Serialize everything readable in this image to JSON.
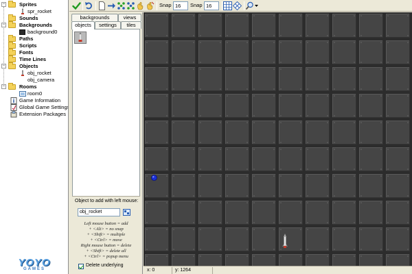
{
  "tree": {
    "sprites": "Sprites",
    "spr_rocket": "spr_rocket",
    "sounds": "Sounds",
    "backgrounds": "Backgrounds",
    "background0": "background0",
    "paths": "Paths",
    "scripts": "Scripts",
    "fonts": "Fonts",
    "time_lines": "Time Lines",
    "objects": "Objects",
    "obj_rocket": "obj_rocket",
    "obj_camera": "obj_camera",
    "rooms": "Rooms",
    "room0": "room0",
    "game_information": "Game Information",
    "global_game_settings": "Global Game Settings",
    "extension_packages": "Extension Packages",
    "expanded_symbol": "−"
  },
  "logo": {
    "main": "YOYO",
    "sub": "GAMES"
  },
  "toolbar": {
    "snap_x_label": "Snap X:",
    "snap_x_value": "16",
    "snap_y_label": "Snap Y:",
    "snap_y_value": "16"
  },
  "tabs": {
    "backgrounds": "backgrounds",
    "views": "views",
    "objects": "objects",
    "settings": "settings",
    "tiles": "tiles",
    "active": "objects"
  },
  "object_panel": {
    "title": "Object to add with left mouse:",
    "selected_object": "obj_rocket",
    "help_lines": [
      "Left mouse button = add",
      "+ <Alt> = no snap",
      "+ <Shift> = multiple",
      "+ <Ctrl> = move",
      "Right mouse button = delete",
      "+ <Shift> = delete all",
      "+ <Ctrl> = popup menu"
    ],
    "delete_underlying_label": "Delete underlying",
    "delete_underlying_checked": true
  },
  "room": {
    "background_color": "#3e3e3e",
    "grid_color": "#1e1e1e",
    "tile_color": "#454545",
    "tile_border_light": "#5a5a5a",
    "instances": [
      {
        "name": "obj_camera",
        "icon": "blue-ball-icon"
      },
      {
        "name": "obj_rocket",
        "icon": "rocket-icon"
      }
    ]
  },
  "status": {
    "x": "x: 0",
    "y": "y: 1264"
  }
}
